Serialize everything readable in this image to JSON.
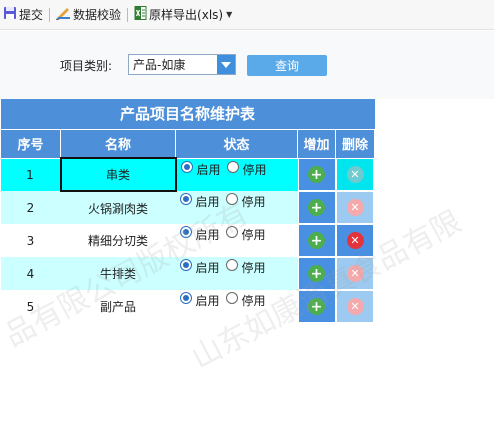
{
  "toolbar": {
    "submit_label": "提交",
    "validate_label": "数据校验",
    "export_label": "原样导出(xls)"
  },
  "query": {
    "category_label": "项目类别:",
    "category_value": "产品-如康",
    "search_button": "查询"
  },
  "table": {
    "title": "产品项目名称维护表",
    "headers": {
      "index": "序号",
      "name": "名称",
      "status": "状态",
      "add": "增加",
      "delete": "删除"
    },
    "rows": [
      {
        "index": "1",
        "name": "串类",
        "enable": "启用",
        "disable": "停用",
        "status": "enabled"
      },
      {
        "index": "2",
        "name": "火锅涮肉类",
        "enable": "启用",
        "disable": "停用",
        "status": "enabled"
      },
      {
        "index": "3",
        "name": "精细分切类",
        "enable": "启用",
        "disable": "停用",
        "status": "enabled"
      },
      {
        "index": "4",
        "name": "牛排类",
        "enable": "启用",
        "disable": "停用",
        "status": "enabled"
      },
      {
        "index": "5",
        "name": "副产品",
        "enable": "启用",
        "disable": "停用",
        "status": "enabled"
      }
    ]
  },
  "watermark": {
    "text_right": "山东如康清真食品有限",
    "text_left": "品有限公司版权所有"
  },
  "colors": {
    "header_blue": "#4d8fd8",
    "row_cyan": "#00ffff",
    "row_light_cyan": "#ccffff",
    "add_green": "#4cae4c",
    "delete_red": "#e2343a",
    "query_button": "#5aa9e8"
  },
  "icons": {
    "submit": "save-disk-icon",
    "validate": "pencil-ruler-icon",
    "export": "excel-file-icon",
    "select": "chevron-down-icon",
    "add": "plus-circle-icon",
    "delete": "x-circle-icon"
  }
}
